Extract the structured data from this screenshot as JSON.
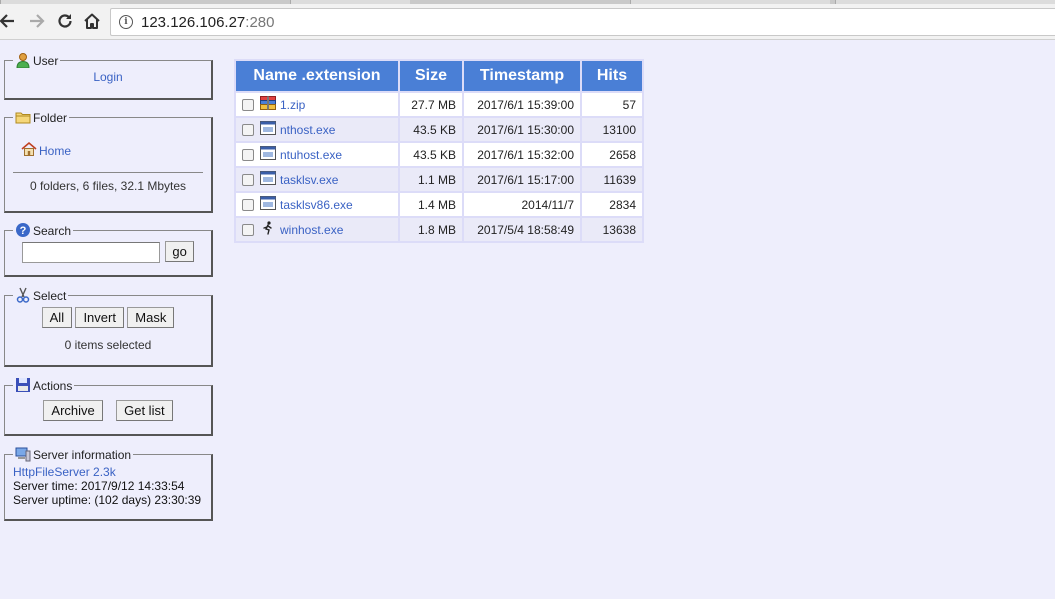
{
  "browser": {
    "url_host": "123.126.106.27",
    "url_port": ":280"
  },
  "user_panel": {
    "legend": "User",
    "login": "Login"
  },
  "folder_panel": {
    "legend": "Folder",
    "home": "Home",
    "summary": "0 folders, 6 files, 32.1 Mbytes"
  },
  "search_panel": {
    "legend": "Search",
    "query": "",
    "go": "go"
  },
  "select_panel": {
    "legend": "Select",
    "all": "All",
    "invert": "Invert",
    "mask": "Mask",
    "status": "0 items selected"
  },
  "actions_panel": {
    "legend": "Actions",
    "archive": "Archive",
    "getlist": "Get list"
  },
  "server_panel": {
    "legend": "Server information",
    "product": "HttpFileServer 2.3k",
    "time": "Server time: 2017/9/12 14:33:54",
    "uptime": "Server uptime: (102 days) 23:30:39"
  },
  "file_table": {
    "headers": {
      "name": "Name .extension",
      "size": "Size",
      "timestamp": "Timestamp",
      "hits": "Hits"
    },
    "rows": [
      {
        "name": "1.zip",
        "icon": "archive-icon",
        "size": "27.7 MB",
        "timestamp": "2017/6/1 15:39:00",
        "hits": "57"
      },
      {
        "name": "nthost.exe",
        "icon": "exe-icon",
        "size": "43.5 KB",
        "timestamp": "2017/6/1 15:30:00",
        "hits": "13100"
      },
      {
        "name": "ntuhost.exe",
        "icon": "exe-icon",
        "size": "43.5 KB",
        "timestamp": "2017/6/1 15:32:00",
        "hits": "2658"
      },
      {
        "name": "tasklsv.exe",
        "icon": "exe-icon",
        "size": "1.1 MB",
        "timestamp": "2017/6/1 15:17:00",
        "hits": "11639"
      },
      {
        "name": "tasklsv86.exe",
        "icon": "exe-icon",
        "size": "1.4 MB",
        "timestamp": "2014/11/7",
        "hits": "2834"
      },
      {
        "name": "winhost.exe",
        "icon": "runner-icon",
        "size": "1.8 MB",
        "timestamp": "2017/5/4 18:58:49",
        "hits": "13638"
      }
    ]
  }
}
